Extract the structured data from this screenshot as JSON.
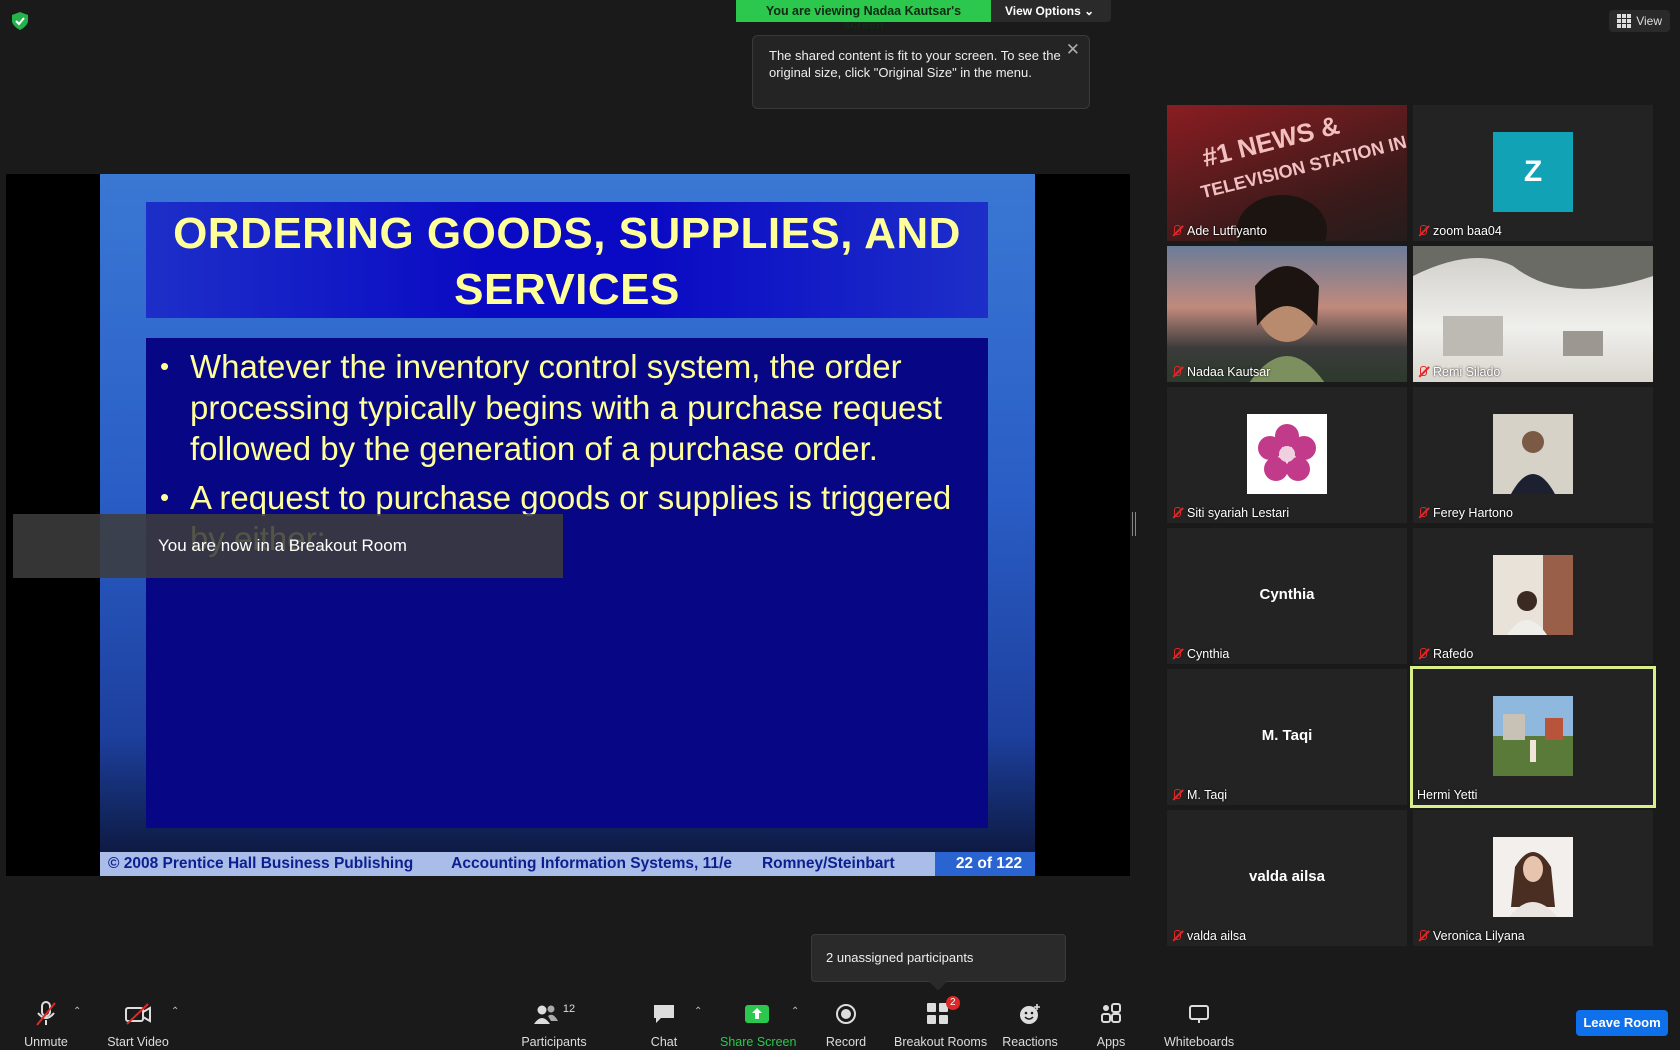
{
  "banner": {
    "viewing": "You are viewing Nadaa Kautsar's screen",
    "view_options": "View Options"
  },
  "view_button": "View",
  "tip": "The shared content is fit to your screen. To see the original size, click \"Original Size\" in the menu.",
  "slide": {
    "title_line1": "ORDERING GOODS, SUPPLIES, AND",
    "title_line2": "SERVICES",
    "bullet1": "Whatever the inventory control system, the order processing typically begins with a purchase request followed by the generation of a purchase order.",
    "bullet2": "A request to purchase goods or supplies is triggered by either:",
    "footer_copyright": "© 2008 Prentice Hall Business Publishing",
    "footer_book": "Accounting Information Systems, 11/e",
    "footer_authors": "Romney/Steinbart",
    "footer_page": "22 of 122"
  },
  "breakout_toast": "You are now in a Breakout Room",
  "participants": [
    {
      "name": "Ade Lutfiyanto",
      "muted": true
    },
    {
      "name": "zoom baa04",
      "muted": true,
      "initial": "Z"
    },
    {
      "name": "Nadaa Kautsar",
      "muted": true
    },
    {
      "name": "Remi Silado",
      "muted": true
    },
    {
      "name": "Siti syariah Lestari",
      "muted": true
    },
    {
      "name": "Ferey Hartono",
      "muted": true
    },
    {
      "name": "Cynthia",
      "muted": true
    },
    {
      "name": "Rafedo",
      "muted": true
    },
    {
      "name": "M. Taqi",
      "muted": true
    },
    {
      "name": "Hermi Yetti",
      "muted": false
    },
    {
      "name": "valda ailsa",
      "muted": true
    },
    {
      "name": "Veronica Lilyana",
      "muted": true
    }
  ],
  "unassigned": "2 unassigned participants",
  "toolbar": {
    "unmute": "Unmute",
    "start_video": "Start Video",
    "participants": "Participants",
    "participants_count": "12",
    "chat": "Chat",
    "share_screen": "Share Screen",
    "record": "Record",
    "breakout_rooms": "Breakout Rooms",
    "breakout_badge": "2",
    "reactions": "Reactions",
    "apps": "Apps",
    "whiteboards": "Whiteboards",
    "leave": "Leave Room"
  },
  "colors": {
    "accent_green": "#2bc84d",
    "leave_blue": "#0e71eb",
    "active_speaker": "#d8f089",
    "muted_red": "#e02828"
  }
}
